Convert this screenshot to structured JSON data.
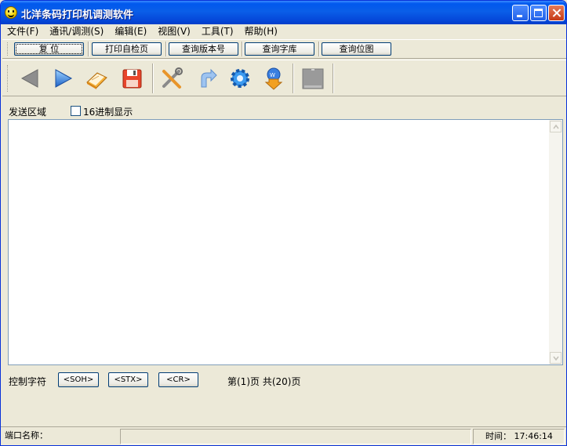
{
  "window": {
    "title": "北洋条码打印机调测软件"
  },
  "menu": [
    {
      "label": "文件(F)"
    },
    {
      "label": "通讯/调测(S)"
    },
    {
      "label": "编辑(E)"
    },
    {
      "label": "视图(V)"
    },
    {
      "label": "工具(T)"
    },
    {
      "label": "帮助(H)"
    }
  ],
  "commands": {
    "reset": "复  位",
    "self_test": "打印自检页",
    "query_version": "查询版本号",
    "query_fonts": "查询字库",
    "query_bitmap": "查询位图"
  },
  "toolbar_icons": [
    "back-arrow-icon",
    "forward-arrow-icon",
    "open-book-icon",
    "save-disk-icon",
    "tools-icon",
    "rotate-arrow-icon",
    "gear-icon",
    "web-download-icon",
    "disabled-device-icon"
  ],
  "send_area": {
    "label": "发送区域",
    "hex_checkbox_label": "16进制显示",
    "hex_checked": false,
    "content": ""
  },
  "control": {
    "label": "控制字符",
    "buttons": [
      "<SOH>",
      "<STX>",
      "<CR>"
    ],
    "page_info": "第(1)页 共(20)页"
  },
  "status": {
    "port": "端口名称：",
    "time": "时间： 17:46:14"
  },
  "colors": {
    "titlebar": "#0A5EE8",
    "face": "#ECE9D8",
    "close": "#C63A15"
  }
}
